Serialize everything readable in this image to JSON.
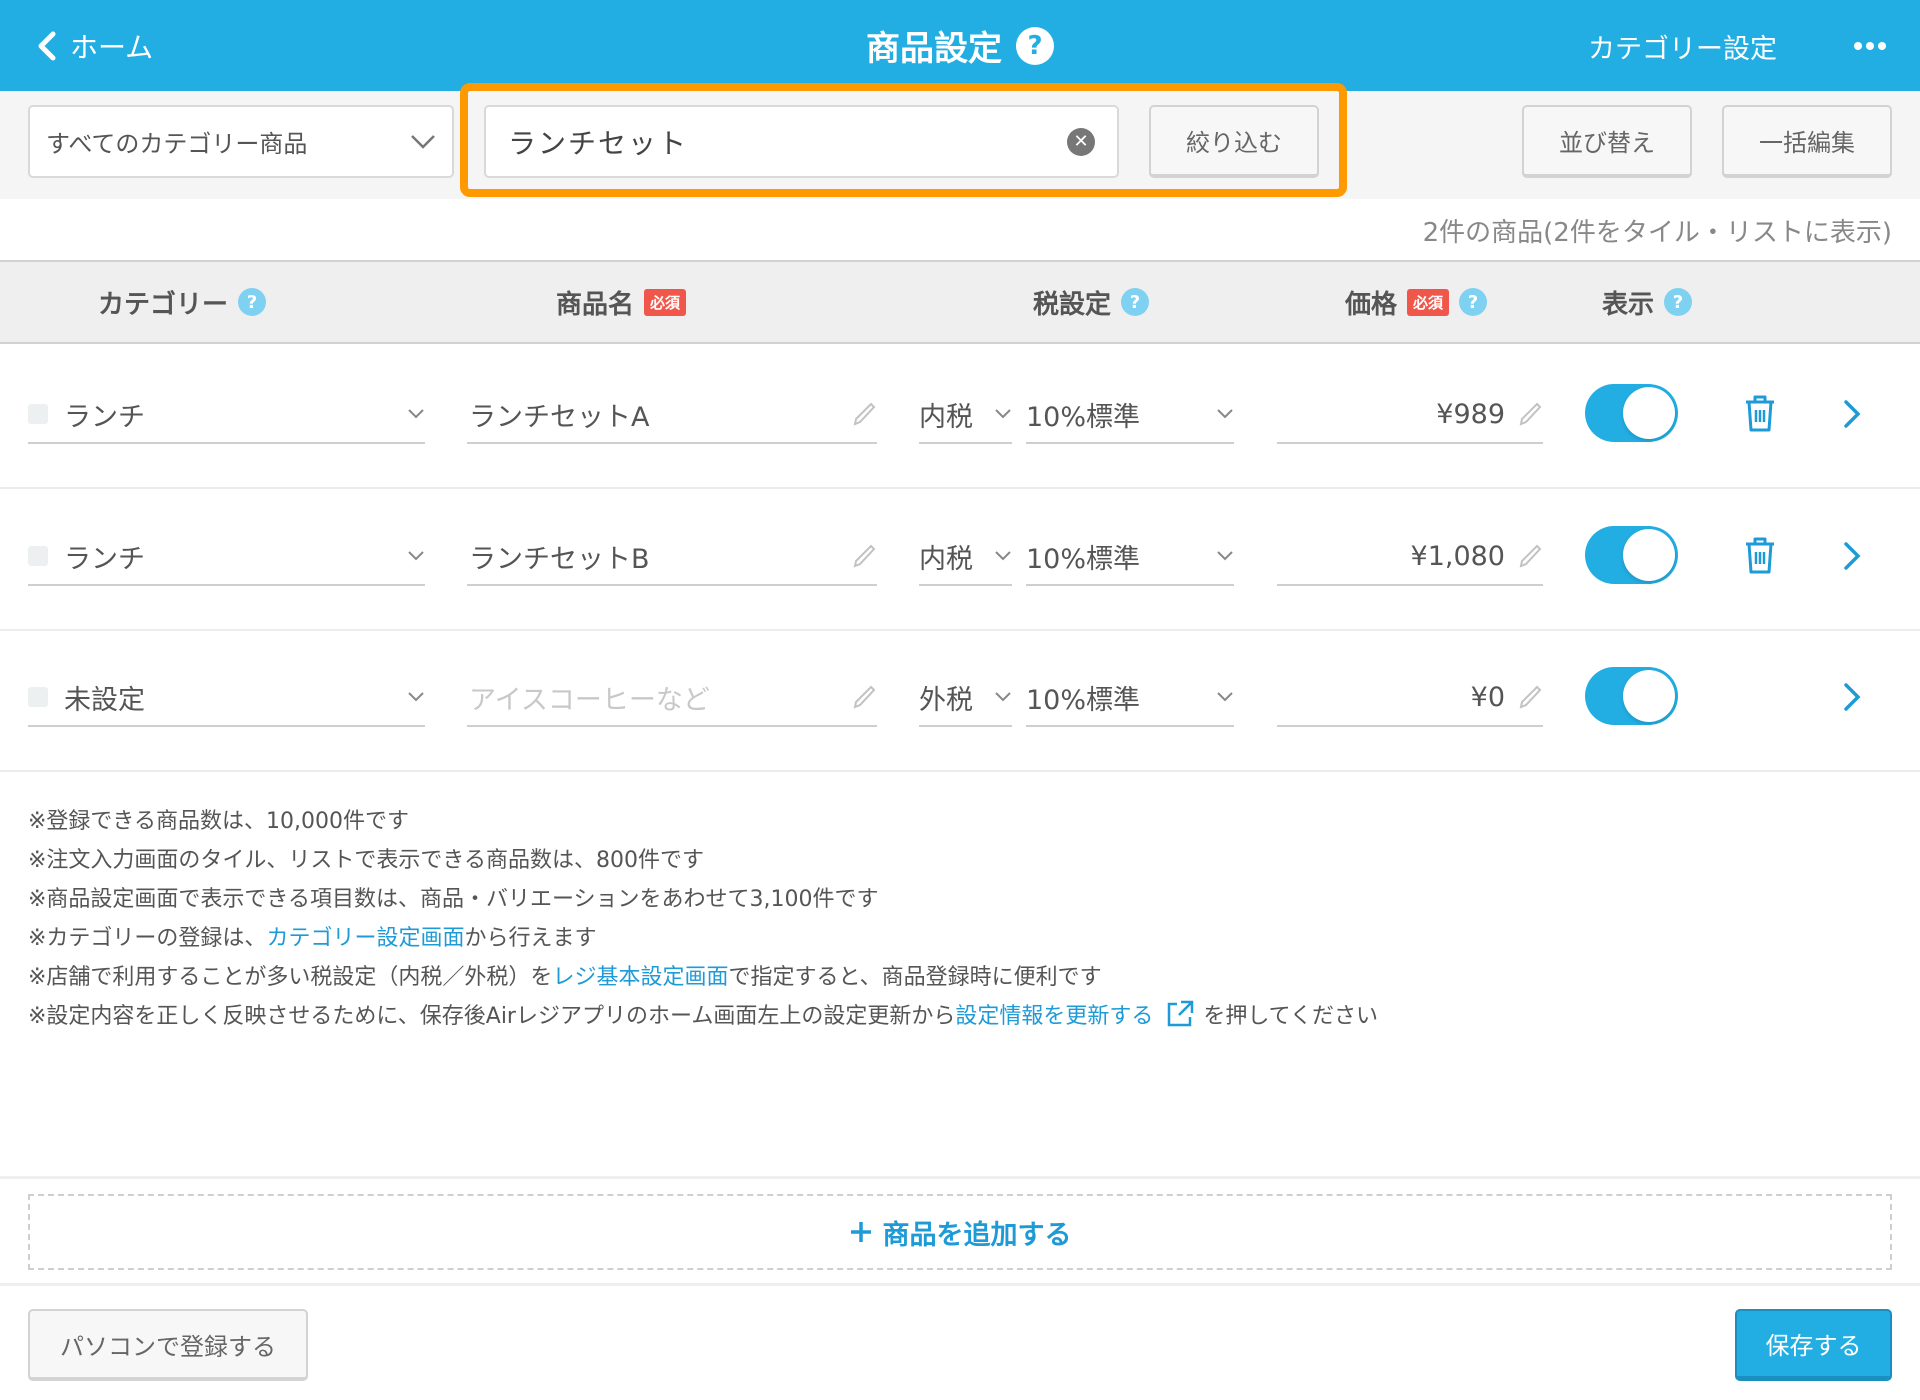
{
  "header": {
    "back_label": "ホーム",
    "title": "商品設定",
    "help_glyph": "?",
    "category_settings_label": "カテゴリー設定",
    "more_icon": "more-horizontal-icon",
    "color": "#23aee3"
  },
  "toolbar": {
    "category_filter": {
      "selected": "すべてのカテゴリー商品"
    },
    "search": {
      "value": "ランチセット",
      "placeholder": ""
    },
    "filter_button": "絞り込む",
    "sort_button": "並び替え",
    "bulk_edit_button": "一括編集",
    "highlight_color": "#ff9900"
  },
  "count_text": "2件の商品(2件をタイル・リストに表示)",
  "table": {
    "columns": [
      {
        "label": "カテゴリー",
        "required": false,
        "help": true
      },
      {
        "label": "商品名",
        "required": true,
        "help": false
      },
      {
        "label": "税設定",
        "required": false,
        "help": true
      },
      {
        "label": "価格",
        "required": true,
        "help": true
      },
      {
        "label": "表示",
        "required": false,
        "help": true
      }
    ],
    "required_badge": "必須",
    "rows": [
      {
        "category": "ランチ",
        "name": "ランチセットA",
        "name_placeholder": "",
        "tax_type": "内税",
        "tax_rate": "10%標準",
        "price": "¥989",
        "visible": true,
        "deletable": true
      },
      {
        "category": "ランチ",
        "name": "ランチセットB",
        "name_placeholder": "",
        "tax_type": "内税",
        "tax_rate": "10%標準",
        "price": "¥1,080",
        "visible": true,
        "deletable": true
      },
      {
        "category": "未設定",
        "name": "",
        "name_placeholder": "アイスコーヒーなど",
        "tax_type": "外税",
        "tax_rate": "10%標準",
        "price": "¥0",
        "visible": true,
        "deletable": false
      }
    ]
  },
  "notes": {
    "line1": "※登録できる商品数は、10,000件です",
    "line2": "※注文入力画面のタイル、リストで表示できる商品数は、800件です",
    "line3": "※商品設定画面で表示できる項目数は、商品・バリエーションをあわせて3,100件です",
    "line4_pre": "※カテゴリーの登録は、",
    "line4_link": "カテゴリー設定画面",
    "line4_post": "から行えます",
    "line5_pre": "※店舗で利用することが多い税設定（内税／外税）を",
    "line5_link": "レジ基本設定画面",
    "line5_post": "で指定すると、商品登録時に便利です",
    "line6_pre": "※設定内容を正しく反映させるために、保存後Airレジアプリのホーム画面左上の設定更新から",
    "line6_link": "設定情報を更新する",
    "line6_post": "を押してください",
    "link_color": "#1e9bd7"
  },
  "add_product_label": "商品を追加する",
  "footer": {
    "pc_register_button": "パソコンで登録する",
    "save_button": "保存する"
  }
}
